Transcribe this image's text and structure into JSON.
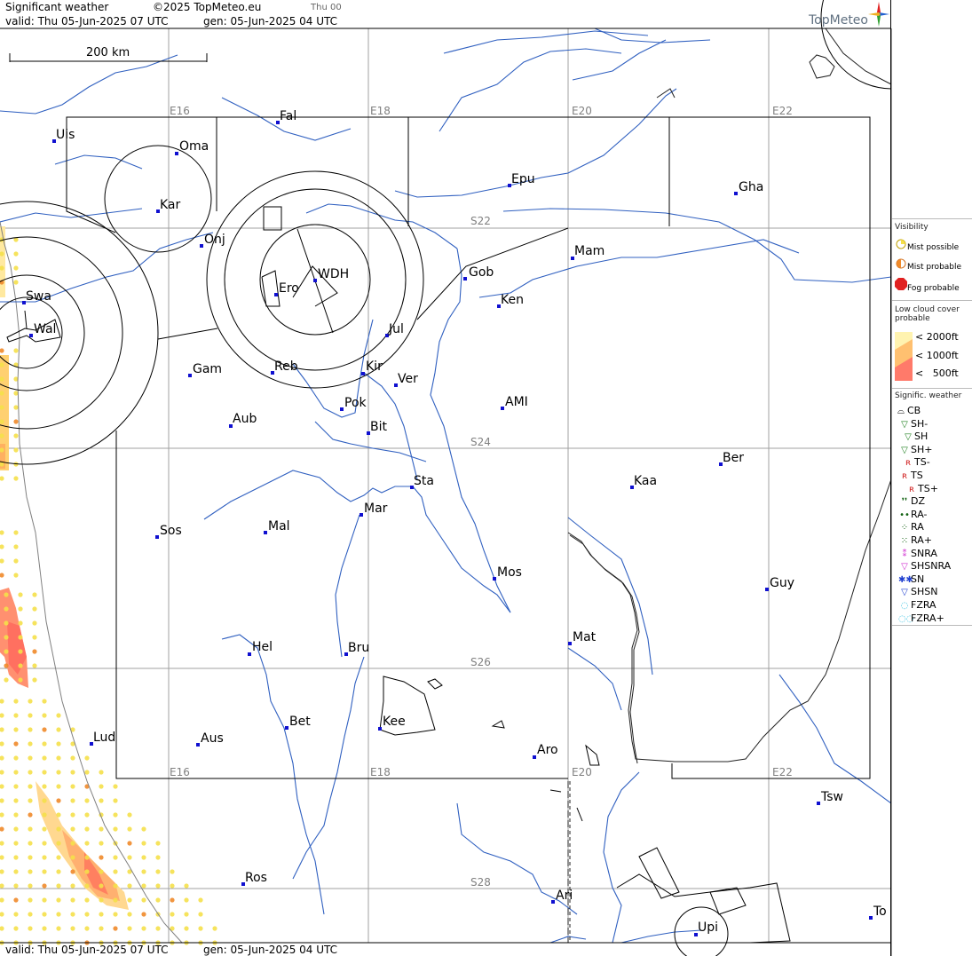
{
  "header": {
    "title": "Significant weather",
    "copyright": "©2025 TopMeteo.eu",
    "day": "Thu 00",
    "valid": "valid:  Thu  05-Jun-2025  07 UTC",
    "gen": "gen: 05-Jun-2025 04 UTC",
    "brand": "TopMeteo"
  },
  "footer": {
    "valid": "valid:  Thu  05-Jun-2025  07 UTC",
    "gen": "gen: 05-Jun-2025 04 UTC"
  },
  "scale": {
    "label": "200 km"
  },
  "grid_labels": {
    "e16_top": "E16",
    "e18_top": "E18",
    "e20_top": "E20",
    "e22_top": "E22",
    "s22": "S22",
    "s24": "S24",
    "s26": "S26",
    "s28": "S28",
    "e16_bot": "E16",
    "e18_bot": "E18",
    "e20_bot": "E20",
    "e22_bot": "E22"
  },
  "cities": [
    {
      "name": "Uis"
    },
    {
      "name": "Fal"
    },
    {
      "name": "Oma"
    },
    {
      "name": "Kar"
    },
    {
      "name": "Epu"
    },
    {
      "name": "Gha"
    },
    {
      "name": "Onj"
    },
    {
      "name": "Swa"
    },
    {
      "name": "Wal"
    },
    {
      "name": "WDH"
    },
    {
      "name": "Ero"
    },
    {
      "name": "Gob"
    },
    {
      "name": "Mam"
    },
    {
      "name": "Ken"
    },
    {
      "name": "Jul"
    },
    {
      "name": "Gam"
    },
    {
      "name": "Reb"
    },
    {
      "name": "Kir"
    },
    {
      "name": "Ver"
    },
    {
      "name": "Pok"
    },
    {
      "name": "AMI"
    },
    {
      "name": "Aub"
    },
    {
      "name": "Bit"
    },
    {
      "name": "Ber"
    },
    {
      "name": "Sta"
    },
    {
      "name": "Kaa"
    },
    {
      "name": "Mar"
    },
    {
      "name": "Sos"
    },
    {
      "name": "Mal"
    },
    {
      "name": "Mos"
    },
    {
      "name": "Guy"
    },
    {
      "name": "Mat"
    },
    {
      "name": "Hel"
    },
    {
      "name": "Bru"
    },
    {
      "name": "Bet"
    },
    {
      "name": "Kee"
    },
    {
      "name": "Lud"
    },
    {
      "name": "Aus"
    },
    {
      "name": "Aro"
    },
    {
      "name": "Tsw"
    },
    {
      "name": "Ros"
    },
    {
      "name": "Ari"
    },
    {
      "name": "Upi"
    },
    {
      "name": "To"
    }
  ],
  "legend": {
    "visibility": {
      "title": "Visibility",
      "items": [
        {
          "label": "Mist possible",
          "color": "#f5e04a"
        },
        {
          "label": "Mist probable",
          "color": "#f08a2a"
        },
        {
          "label": "Fog probable",
          "color": "#e02020"
        }
      ]
    },
    "low_cloud": {
      "title": "Low cloud cover probable",
      "items": [
        {
          "label": "< 2000ft",
          "color": "#fff3b0"
        },
        {
          "label": "< 1000ft",
          "color": "#ffc070"
        },
        {
          "label": "<   500ft",
          "color": "#ff7a6a"
        }
      ]
    },
    "significant": {
      "title": "Signific. weather",
      "items": [
        {
          "label": "CB",
          "icon": "cb-icon",
          "color": "#000000"
        },
        {
          "label": "SH-",
          "icon": "shower-light-icon",
          "color": "#208020"
        },
        {
          "label": "SH",
          "icon": "shower-icon",
          "color": "#208020"
        },
        {
          "label": "SH+",
          "icon": "shower-heavy-icon",
          "color": "#208020"
        },
        {
          "label": "TS-",
          "icon": "thunderstorm-light-icon",
          "color": "#d02020"
        },
        {
          "label": "TS",
          "icon": "thunderstorm-icon",
          "color": "#d02020"
        },
        {
          "label": "TS+",
          "icon": "thunderstorm-heavy-icon",
          "color": "#d02020"
        },
        {
          "label": "DZ",
          "icon": "drizzle-icon",
          "color": "#106010"
        },
        {
          "label": "RA-",
          "icon": "rain-light-icon",
          "color": "#106010"
        },
        {
          "label": "RA",
          "icon": "rain-icon",
          "color": "#106010"
        },
        {
          "label": "RA+",
          "icon": "rain-heavy-icon",
          "color": "#106010"
        },
        {
          "label": "SNRA",
          "icon": "snow-rain-icon",
          "color": "#d030d0"
        },
        {
          "label": "SHSNRA",
          "icon": "snow-rain-shower-icon",
          "color": "#d030d0"
        },
        {
          "label": "SN",
          "icon": "snow-icon",
          "color": "#2040d0"
        },
        {
          "label": "SHSN",
          "icon": "snow-shower-icon",
          "color": "#2040d0"
        },
        {
          "label": "FZRA",
          "icon": "freezing-rain-icon",
          "color": "#30c0e0"
        },
        {
          "label": "FZRA+",
          "icon": "freezing-rain-heavy-icon",
          "color": "#30c0e0"
        }
      ]
    }
  }
}
